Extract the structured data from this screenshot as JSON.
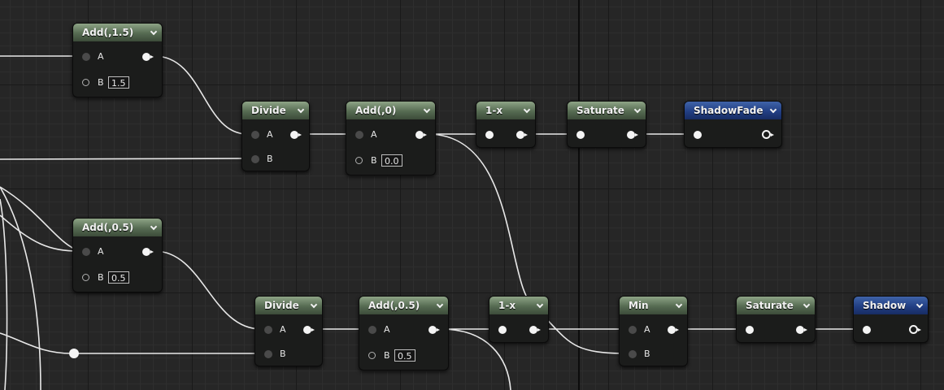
{
  "nodes": {
    "add_1_5": {
      "title": "Add(,1.5)",
      "pin_a": "A",
      "pin_b": "B",
      "value_b": "1.5"
    },
    "divide_top": {
      "title": "Divide",
      "pin_a": "A",
      "pin_b": "B"
    },
    "add_0": {
      "title": "Add(,0)",
      "pin_a": "A",
      "pin_b": "B",
      "value_b": "0.0"
    },
    "one_minus_top": {
      "title": "1-x"
    },
    "saturate_top": {
      "title": "Saturate"
    },
    "shadow_fade": {
      "title": "ShadowFade"
    },
    "add_0_5_left": {
      "title": "Add(,0.5)",
      "pin_a": "A",
      "pin_b": "B",
      "value_b": "0.5"
    },
    "divide_bottom": {
      "title": "Divide",
      "pin_a": "A",
      "pin_b": "B"
    },
    "add_0_5_mid": {
      "title": "Add(,0.5)",
      "pin_a": "A",
      "pin_b": "B",
      "value_b": "0.5"
    },
    "one_minus_bottom": {
      "title": "1-x"
    },
    "min": {
      "title": "Min",
      "pin_a": "A",
      "pin_b": "B"
    },
    "saturate_bottom": {
      "title": "Saturate"
    },
    "shadow": {
      "title": "Shadow"
    }
  },
  "colors": {
    "graph_background": "#262626",
    "math_node_header": "#566b52",
    "output_node_header": "#223f84",
    "wire": "#e8e8e8"
  }
}
